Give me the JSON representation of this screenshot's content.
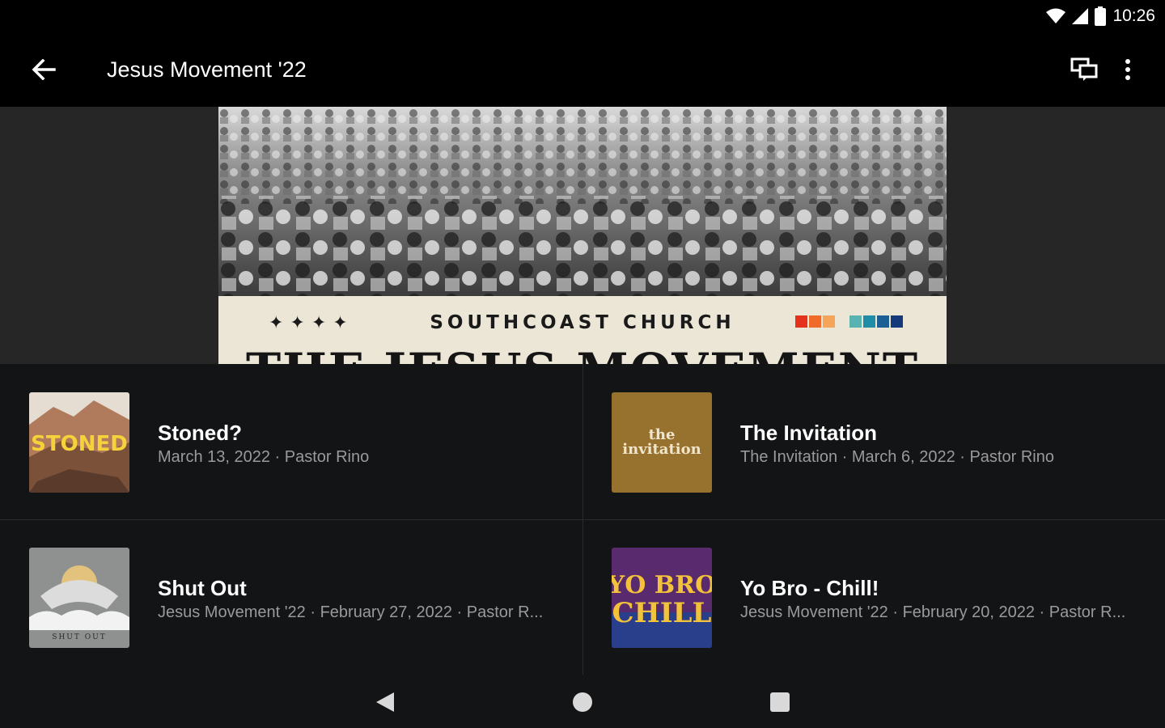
{
  "status_bar": {
    "time": "10:26"
  },
  "toolbar": {
    "title": "Jesus Movement '22"
  },
  "hero": {
    "church": "SOUTHCOAST CHURCH",
    "stars": "✦✦✦✦",
    "headline": "THE JESUS MOVEMENT",
    "swatch_colors": [
      "#e5321d",
      "#f06b2a",
      "#f5a55a",
      "#58b3b1",
      "#1f8ca8",
      "#1c5f95",
      "#15397a"
    ]
  },
  "sermons": [
    {
      "title": "Stoned?",
      "subtitle": "March 13, 2022 · Pastor Rino",
      "thumb_text": "STONED"
    },
    {
      "title": "The Invitation",
      "subtitle": "The Invitation · March 6, 2022 · Pastor Rino",
      "thumb_text_1": "the",
      "thumb_text_2": "invitation"
    },
    {
      "title": "Shut Out",
      "subtitle": "Jesus Movement '22 · February 27, 2022 · Pastor R...",
      "thumb_text": "SHUT OUT"
    },
    {
      "title": "Yo Bro - Chill!",
      "subtitle": "Jesus Movement '22 · February 20, 2022 · Pastor R...",
      "thumb_text_1": "YO BRO",
      "thumb_text_2": "CHILL"
    }
  ]
}
